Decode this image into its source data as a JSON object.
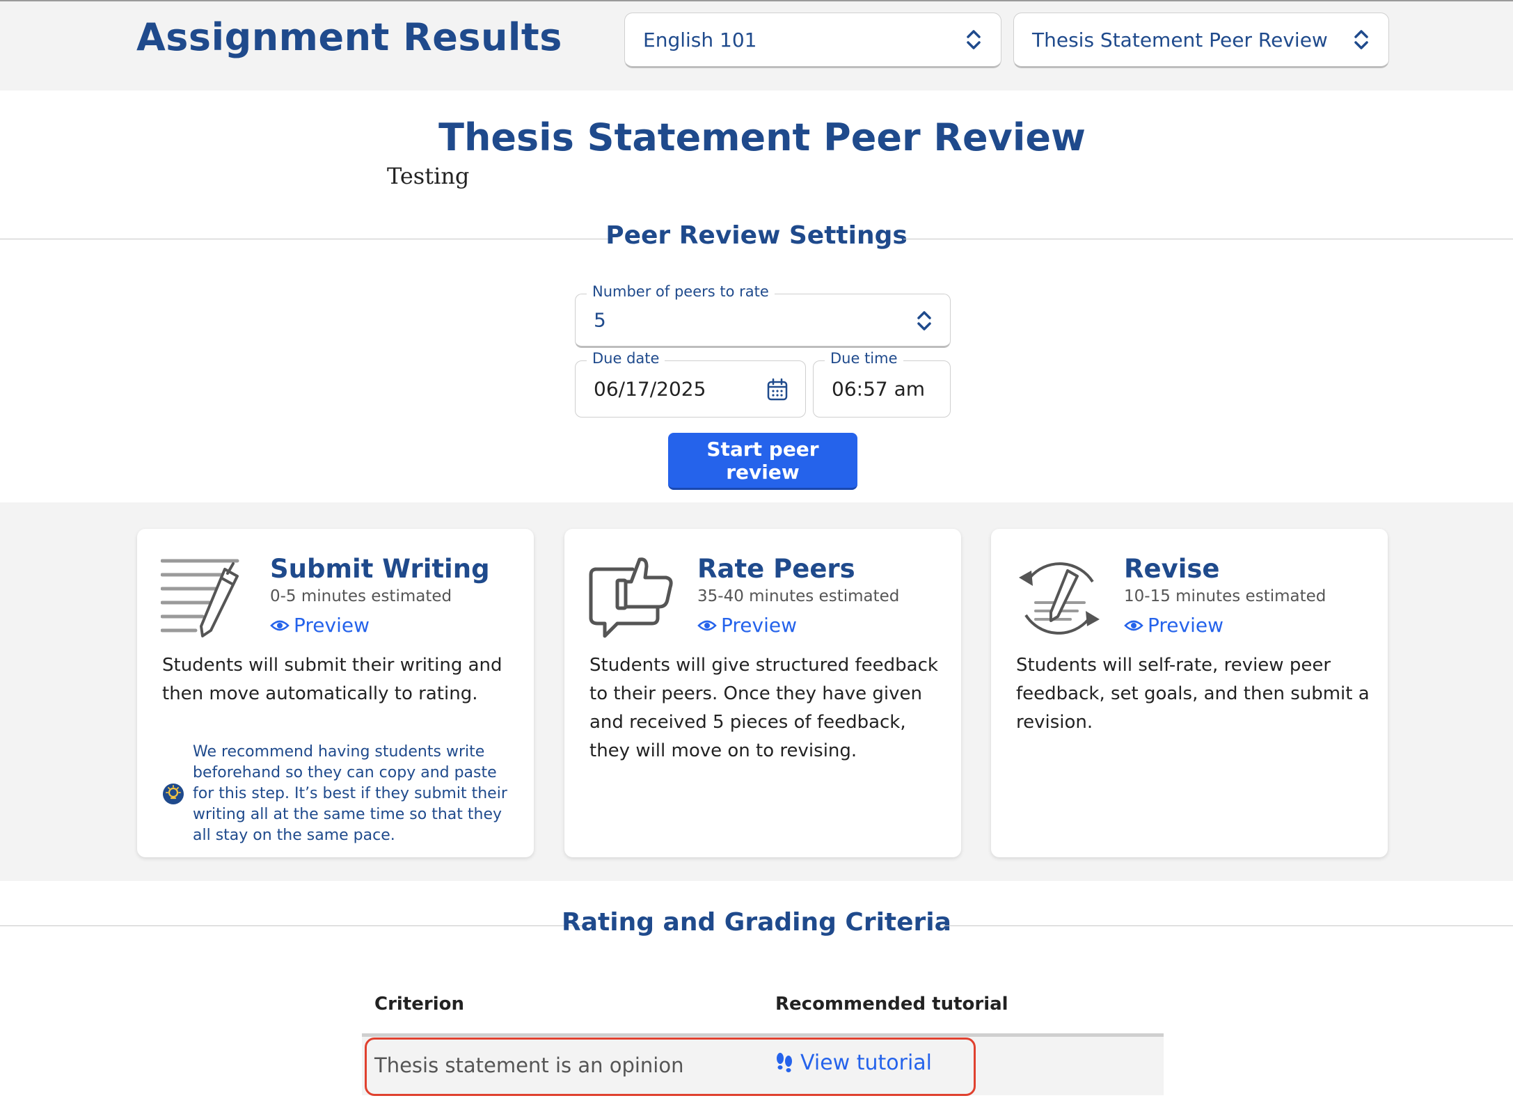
{
  "header": {
    "title": "Assignment Results",
    "course_select": "English 101",
    "assignment_select": "Thesis Statement Peer Review"
  },
  "assignment": {
    "title": "Thesis Statement Peer Review",
    "description": "Testing"
  },
  "settings": {
    "heading": "Peer Review Settings",
    "peers_label": "Number of peers to rate",
    "peers_value": "5",
    "due_date_label": "Due date",
    "due_date_value": "06/17/2025",
    "due_time_label": "Due time",
    "due_time_value": "06:57 am",
    "start_button": "Start peer review"
  },
  "steps": [
    {
      "title": "Submit Writing",
      "estimate": "0-5 minutes estimated",
      "preview": "Preview",
      "description": "Students will submit their writing and then move automatically to rating.",
      "tip": "We recommend having students write beforehand so they can copy and paste for this step. It’s best if they submit their writing all at the same time so that they all stay on the same pace.",
      "icon": "writing-pencil-icon"
    },
    {
      "title": "Rate Peers",
      "estimate": "35-40 minutes estimated",
      "preview": "Preview",
      "description": "Students will give structured feedback to their peers. Once they have given and received 5 pieces of feedback, they will move on to revising.",
      "icon": "thumbs-up-speech-icon"
    },
    {
      "title": "Revise",
      "estimate": "10-15 minutes estimated",
      "preview": "Preview",
      "description": "Students will self-rate, review peer feedback, set goals, and then submit a revision.",
      "icon": "revise-cycle-icon"
    }
  ],
  "criteria": {
    "heading": "Rating and Grading Criteria",
    "columns": [
      "Criterion",
      "Recommended tutorial"
    ],
    "rows": [
      {
        "criterion": "Thesis statement is an opinion",
        "tutorial": "View tutorial"
      }
    ]
  },
  "colors": {
    "brand_navy": "#1f4a8c",
    "accent_blue": "#2563eb",
    "highlight_red": "#e0412f",
    "band_gray": "#f3f3f3"
  }
}
